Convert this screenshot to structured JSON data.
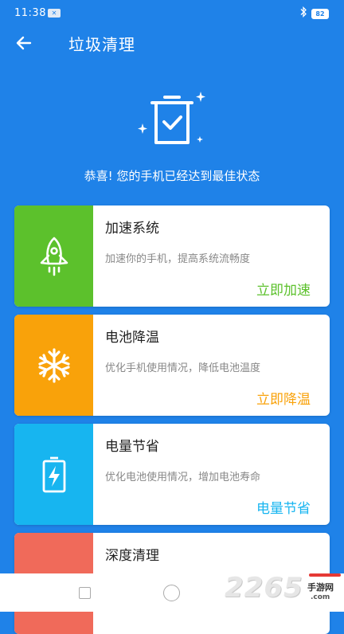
{
  "status_bar": {
    "time": "11:38",
    "battery": "82"
  },
  "app_bar": {
    "title": "垃圾清理"
  },
  "hero": {
    "message": "恭喜! 您的手机已经达到最佳状态"
  },
  "cards": [
    {
      "title": "加速系统",
      "desc": "加速你的手机，提高系统流畅度",
      "action": "立即加速",
      "color": "#5cc12c",
      "icon": "rocket-icon"
    },
    {
      "title": "电池降温",
      "desc": "优化手机使用情况，降低电池温度",
      "action": "立即降温",
      "color": "#f9a20a",
      "icon": "snowflake-icon"
    },
    {
      "title": "电量节省",
      "desc": "优化电池使用情况，增加电池寿命",
      "action": "电量节省",
      "color": "#17b5f0",
      "icon": "battery-charging-icon"
    },
    {
      "title": "深度清理",
      "desc": "",
      "action": "",
      "color": "#f06a5a",
      "icon": "clean-icon"
    }
  ],
  "watermark": {
    "number": "2265",
    "suffix": "手游网",
    "domain": ".com"
  }
}
